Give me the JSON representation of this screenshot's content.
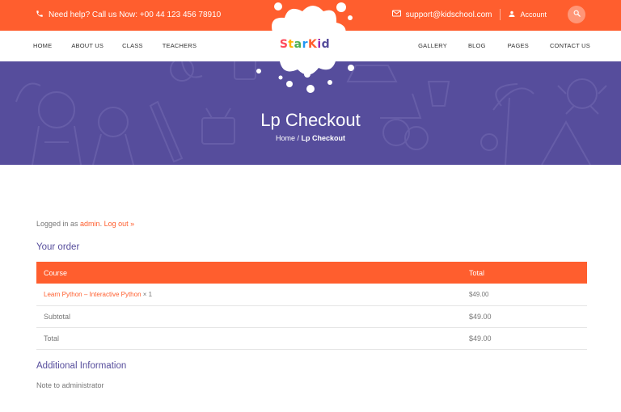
{
  "topbar": {
    "help_text": "Need help? Call us Now: +00 44 123 456 78910",
    "email": "support@kidschool.com",
    "account_label": "Account"
  },
  "logo": {
    "text": "StarKid"
  },
  "nav": {
    "left": [
      "HOME",
      "ABOUT US",
      "CLASS",
      "TEACHERS"
    ],
    "right": [
      "GALLERY",
      "BLOG",
      "PAGES",
      "CONTACT US"
    ]
  },
  "hero": {
    "title": "Lp Checkout",
    "breadcrumb_home": "Home",
    "breadcrumb_sep": " / ",
    "breadcrumb_current": "Lp Checkout"
  },
  "login": {
    "prefix": "Logged in as ",
    "user": "admin",
    "dot": ". ",
    "logout": "Log out »"
  },
  "order": {
    "heading": "Your order",
    "headers": {
      "course": "Course",
      "total": "Total"
    },
    "item": {
      "name": "Learn Python – Interactive Python",
      "qty": " × 1",
      "price": "$49.00"
    },
    "subtotal": {
      "label": "Subtotal",
      "value": "$49.00"
    },
    "total": {
      "label": "Total",
      "value": "$49.00"
    }
  },
  "additional": {
    "heading": "Additional Information",
    "note_label": "Note to administrator"
  },
  "colors": {
    "accent": "#ff5e2e",
    "purple": "#564d9c"
  }
}
